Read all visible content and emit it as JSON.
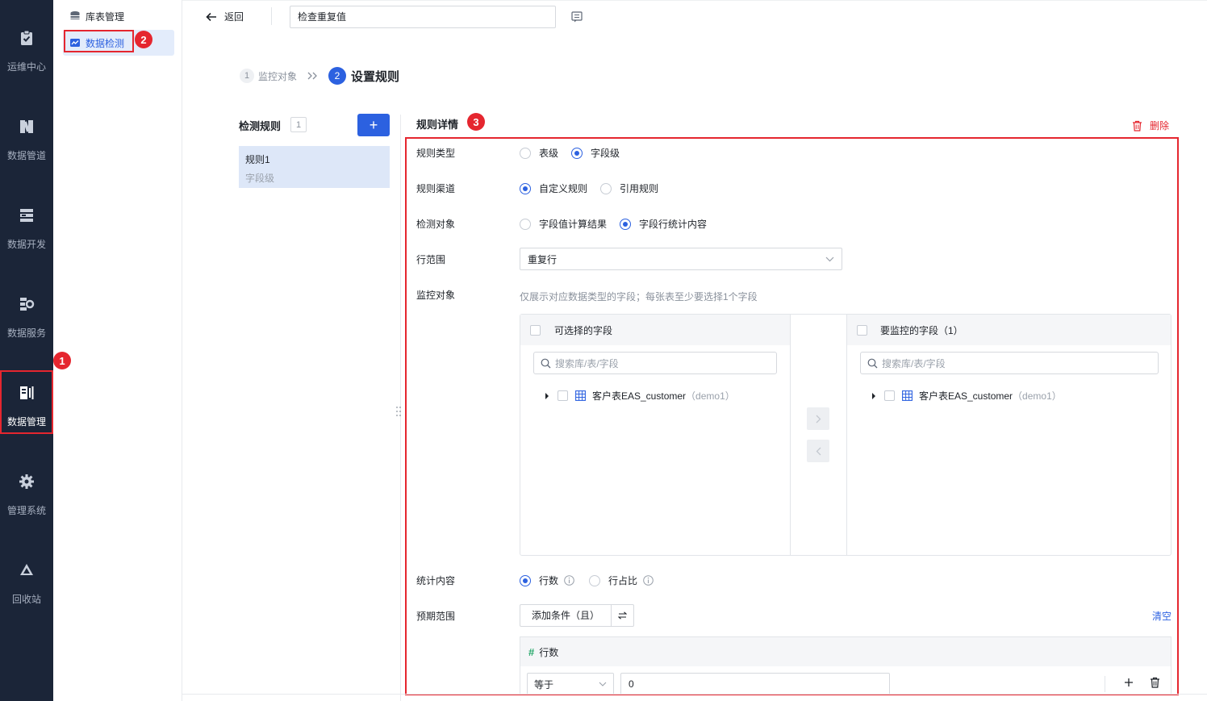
{
  "nav": {
    "items": [
      {
        "label": "运维中心",
        "icon": "clipboard-check-icon"
      },
      {
        "label": "数据管道",
        "icon": "pipeline-icon"
      },
      {
        "label": "数据开发",
        "icon": "stack-icon"
      },
      {
        "label": "数据服务",
        "icon": "service-icon"
      },
      {
        "label": "数据管理",
        "icon": "data-manage-icon"
      },
      {
        "label": "管理系统",
        "icon": "gear-icon"
      },
      {
        "label": "回收站",
        "icon": "recycle-icon"
      }
    ],
    "active_index": 4
  },
  "subnav": {
    "items": [
      {
        "label": "库表管理",
        "icon": "database-icon"
      },
      {
        "label": "数据检测",
        "icon": "monitor-icon"
      }
    ],
    "active_index": 1
  },
  "annotations": {
    "badge1": "1",
    "badge2": "2",
    "badge3": "3"
  },
  "topbar": {
    "back_label": "返回",
    "title_value": "检查重复值"
  },
  "steps": [
    {
      "num": "1",
      "label": "监控对象"
    },
    {
      "num": "2",
      "label": "设置规则"
    }
  ],
  "rules_panel": {
    "title": "检测规则",
    "count": "1",
    "add_label": "+",
    "items": [
      {
        "name": "规则1",
        "sub": "字段级"
      }
    ]
  },
  "detail": {
    "title": "规则详情",
    "delete_label": "删除",
    "rule_type": {
      "label": "规则类型",
      "options": [
        "表级",
        "字段级"
      ],
      "selected": 1
    },
    "rule_channel": {
      "label": "规则渠道",
      "options": [
        "自定义规则",
        "引用规则"
      ],
      "selected": 0
    },
    "detect_target": {
      "label": "检测对象",
      "options": [
        "字段值计算结果",
        "字段行统计内容"
      ],
      "selected": 1
    },
    "row_range": {
      "label": "行范围",
      "value": "重复行"
    },
    "monitor": {
      "label": "监控对象",
      "hint": "仅展示对应数据类型的字段；每张表至少要选择1个字段",
      "left_title": "可选择的字段",
      "right_title": "要监控的字段（1）",
      "search_placeholder": "搜索库/表/字段",
      "table_name": "客户表EAS_customer",
      "table_db": "（demo1）"
    },
    "stat_content": {
      "label": "统计内容",
      "options": [
        "行数",
        "行占比"
      ],
      "selected": 0
    },
    "expect_range": {
      "label": "预期范围",
      "add_condition": "添加条件（且）",
      "clear_label": "清空",
      "field_label": "行数",
      "operator": "等于",
      "value": "0"
    }
  },
  "colors": {
    "primary": "#2c61e0",
    "annotation_red": "#e5262f",
    "nav_bg": "#1b2538"
  }
}
